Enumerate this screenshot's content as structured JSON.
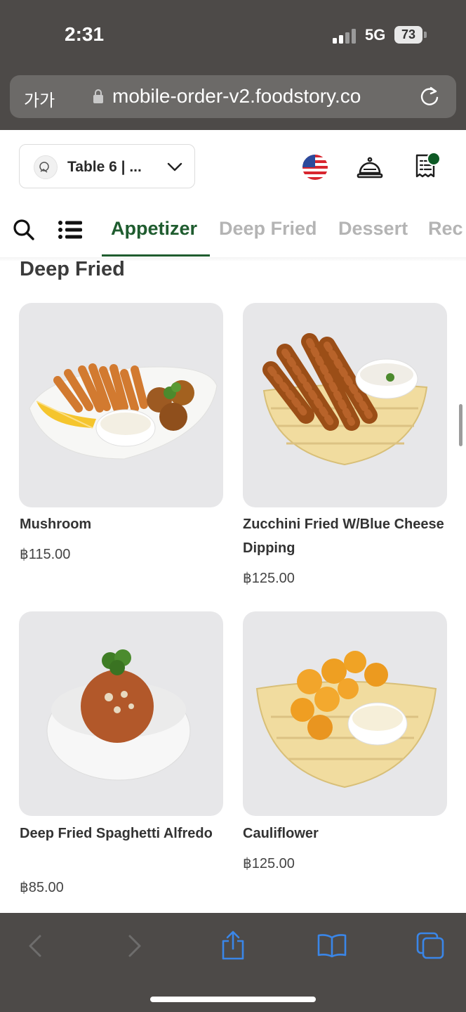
{
  "status_bar": {
    "time": "2:31",
    "network": "5G",
    "battery": "73"
  },
  "browser": {
    "text_size_label": "가가",
    "url": "mobile-order-v2.foodstory.co"
  },
  "header": {
    "table_label": "Table 6 | ..."
  },
  "category_nav": {
    "tabs": [
      {
        "label": "Appetizer",
        "active": true
      },
      {
        "label": "Deep Fried",
        "active": false
      },
      {
        "label": "Dessert",
        "active": false
      },
      {
        "label": "Rec",
        "active": false
      }
    ]
  },
  "section": {
    "title": "Deep Fried"
  },
  "products": [
    {
      "name": "Mushroom",
      "price": "฿115.00"
    },
    {
      "name": "Zucchini Fried W/Blue Cheese Dipping",
      "price": "฿125.00"
    },
    {
      "name": "Deep Fried Spaghetti Alfredo",
      "price": "฿85.00"
    },
    {
      "name": "Cauliflower",
      "price": "฿125.00"
    }
  ],
  "colors": {
    "accent": "#1f5c2f",
    "inactive_tab": "#b4b4b4",
    "toolbar_icon": "#3a86e8"
  },
  "icons": [
    "lock-icon",
    "reload-icon",
    "chevron-down-icon",
    "us-flag-icon",
    "service-bell-icon",
    "receipt-icon",
    "search-icon",
    "menu-list-icon",
    "back-icon",
    "forward-icon",
    "share-icon",
    "bookmarks-icon",
    "tabs-icon"
  ]
}
